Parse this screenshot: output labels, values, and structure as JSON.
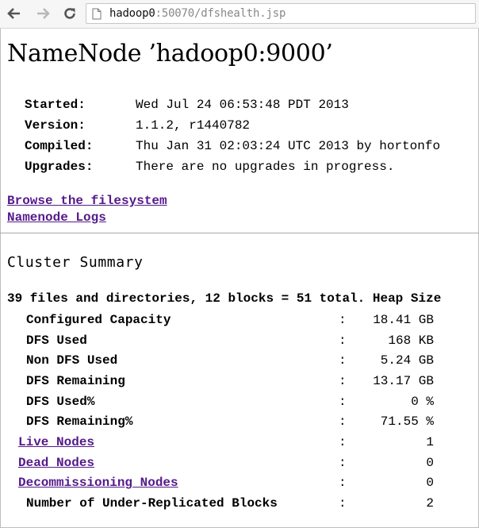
{
  "browser": {
    "url_host": "hadoop0",
    "url_rest": ":50070/dfshealth.jsp"
  },
  "page": {
    "title": "NameNode ’hadoop0:9000’",
    "info": [
      {
        "label": "Started:",
        "value": "Wed Jul 24 06:53:48 PDT 2013"
      },
      {
        "label": "Version:",
        "value": "1.1.2, r1440782"
      },
      {
        "label": "Compiled:",
        "value": "Thu Jan 31 02:03:24 UTC 2013 by hortonfo"
      },
      {
        "label": "Upgrades:",
        "value": "There are no upgrades in progress."
      }
    ],
    "links": {
      "browse": "Browse the filesystem",
      "logs": "Namenode Logs"
    },
    "cluster_summary": {
      "heading": "Cluster Summary",
      "summary_line": "39 files and directories, 12 blocks = 51 total. Heap Size",
      "separator": ":",
      "rows": [
        {
          "label": "Configured Capacity",
          "value": "18.41 GB"
        },
        {
          "label": "DFS Used",
          "value": "168 KB"
        },
        {
          "label": "Non DFS Used",
          "value": "5.24 GB"
        },
        {
          "label": "DFS Remaining",
          "value": "13.17 GB"
        },
        {
          "label": "DFS Used%",
          "value": "0 %"
        },
        {
          "label": "DFS Remaining%",
          "value": "71.55 %"
        },
        {
          "label": "Live Nodes",
          "value": "1"
        },
        {
          "label": "Dead Nodes",
          "value": "0"
        },
        {
          "label": "Decommissioning Nodes",
          "value": "0"
        },
        {
          "label": "Number of Under-Replicated Blocks",
          "value": "2"
        }
      ]
    }
  },
  "colors": {
    "link": "#551a8b",
    "toolbar_bg": "#f6f6f6"
  }
}
